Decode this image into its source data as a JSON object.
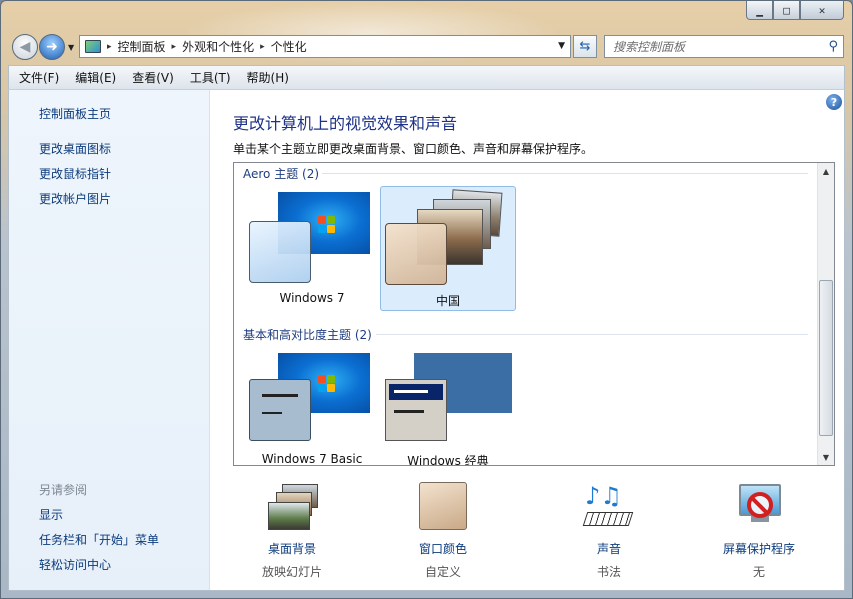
{
  "window": {
    "min_glyph": "▁",
    "max_glyph": "□",
    "close_glyph": "✕"
  },
  "address_bar": {
    "breadcrumbs": [
      "控制面板",
      "外观和个性化",
      "个性化"
    ],
    "separator": "▸"
  },
  "search": {
    "placeholder": "搜索控制面板"
  },
  "menu": [
    "文件(F)",
    "编辑(E)",
    "查看(V)",
    "工具(T)",
    "帮助(H)"
  ],
  "sidebar": {
    "home": "控制面板主页",
    "links": [
      "更改桌面图标",
      "更改鼠标指针",
      "更改帐户图片"
    ],
    "see_also_heading": "另请参阅",
    "see_also": [
      "显示",
      "任务栏和「开始」菜单",
      "轻松访问中心"
    ]
  },
  "main": {
    "title": "更改计算机上的视觉效果和声音",
    "description": "单击某个主题立即更改桌面背景、窗口颜色、声音和屏幕保护程序。"
  },
  "theme_groups": [
    {
      "label": "Aero 主题 (2)",
      "themes": [
        "Windows 7",
        "中国"
      ]
    },
    {
      "label": "基本和高对比度主题 (2)",
      "themes": [
        "Windows 7 Basic",
        "Windows 经典"
      ]
    }
  ],
  "selected_theme": "中国",
  "bottom_tiles": [
    {
      "link": "桌面背景",
      "sub": "放映幻灯片"
    },
    {
      "link": "窗口颜色",
      "sub": "自定义"
    },
    {
      "link": "声音",
      "sub": "书法"
    },
    {
      "link": "屏幕保护程序",
      "sub": "无"
    }
  ],
  "colors": {
    "link": "#0c3b7c",
    "title": "#1e3287",
    "sidebar_bg": "#eef5fc",
    "selection": "#dbecfc"
  },
  "icons": [
    "back-arrow-icon",
    "forward-arrow-icon",
    "control-panel-icon",
    "refresh-icon",
    "search-icon",
    "help-icon",
    "music-notes-icon",
    "no-entry-icon"
  ]
}
